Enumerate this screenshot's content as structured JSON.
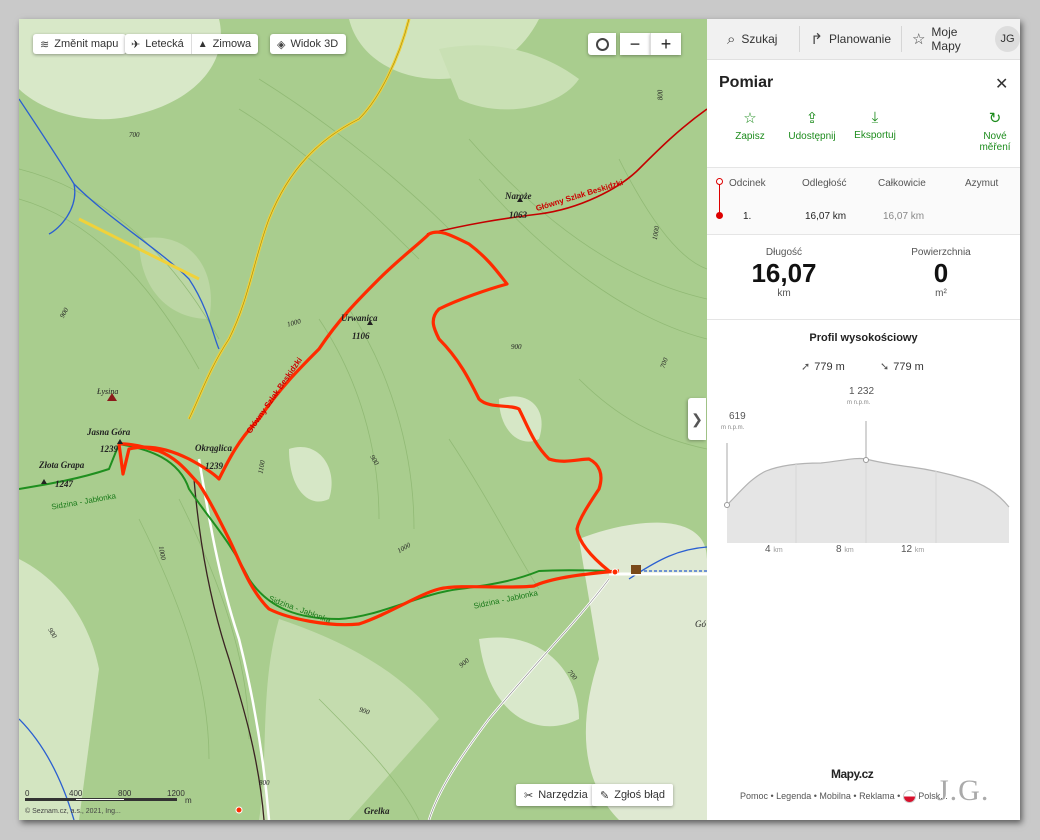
{
  "toolbar": {
    "change_map": "Změnit mapu",
    "layer_aerial": "Letecká",
    "layer_winter": "Zimowa",
    "layer_3d": "Widok 3D",
    "zoom_out": "−",
    "zoom_in": "+"
  },
  "map_labels": {
    "naroze": "Naroże",
    "naroze_h": "1063",
    "urwanica": "Urwanica",
    "urwanica_h": "1106",
    "jasna_gora": "Jasna Góra",
    "jasna_gora_h": "1239",
    "zlota_grapa": "Złota Grapa",
    "zlota_grapa_h": "1247",
    "okraglica": "Okrąglica",
    "okraglica_h": "1239",
    "lysina": "Łysina",
    "grelka": "Grelka",
    "go": "Gó",
    "main_trail_1": "Główny Szlak Beskidzki",
    "main_trail_2": "Główny Szlak Beskidzki",
    "green_trail_1": "Sidzina - Jabłonka",
    "green_trail_2": "Sidzina - Jabłonka",
    "green_trail_3": "Sidzina - Jabłonka",
    "contour_1": "700",
    "contour_2": "900",
    "contour_3": "1000",
    "contour_4": "900",
    "contour_5": "800",
    "contour_6": "1000",
    "contour_7": "1100",
    "contour_8": "900",
    "contour_9": "1000",
    "contour_10": "700",
    "contour_11": "800",
    "contour_12": "900",
    "contour_13": "700",
    "contour_14": "900",
    "contour_15": "1000",
    "contour_16": "900"
  },
  "scale": {
    "t0": "0",
    "t1": "400",
    "t2": "800",
    "t3": "1200",
    "unit": "m"
  },
  "copyright": "© Seznam.cz, a.s., 2021, Ing...",
  "map_buttons": {
    "tools": "Narzędzia",
    "report": "Zgłoś błąd"
  },
  "topbar": {
    "search": "Szukaj",
    "planning": "Planowanie",
    "my_maps": "Moje Mapy",
    "avatar": "JG"
  },
  "panel": {
    "title": "Pomiar",
    "actions": {
      "save": "Zapisz",
      "share": "Udostępnij",
      "export": "Eksportuj",
      "new_line1": "Nové",
      "new_line2": "měření"
    },
    "table": {
      "headers": [
        "Odcinek",
        "Odległość",
        "Całkowicie",
        "Azymut"
      ],
      "rows": [
        {
          "segment": "1.",
          "distance": "16,07 km",
          "total": "16,07 km",
          "azimuth": ""
        }
      ]
    },
    "stats": {
      "length_label": "Długość",
      "length_value": "16,07",
      "length_unit": "km",
      "area_label": "Powierzchnia",
      "area_value": "0",
      "area_unit": "m²"
    },
    "profile": {
      "title": "Profil wysokościowy",
      "ascent": "779 m",
      "descent": "779 m",
      "start_elev": "619",
      "start_unit": "m n.p.m.",
      "max_elev": "1 232",
      "max_unit": "m n.p.m.",
      "x_ticks": [
        "4",
        "8",
        "12"
      ],
      "x_unit": "km"
    }
  },
  "footer": {
    "logo": "Mapy.cz",
    "links": [
      "Pomoc",
      "Legenda",
      "Mobilna",
      "Reklama",
      "Polsk..."
    ],
    "signature": "J.G."
  },
  "colors": {
    "route": "#ff2b00",
    "main_trail": "#c40000",
    "green_trail": "#1f8f1f",
    "accent_green": "#1d8c1d",
    "map_base": "#a9cd8e"
  }
}
